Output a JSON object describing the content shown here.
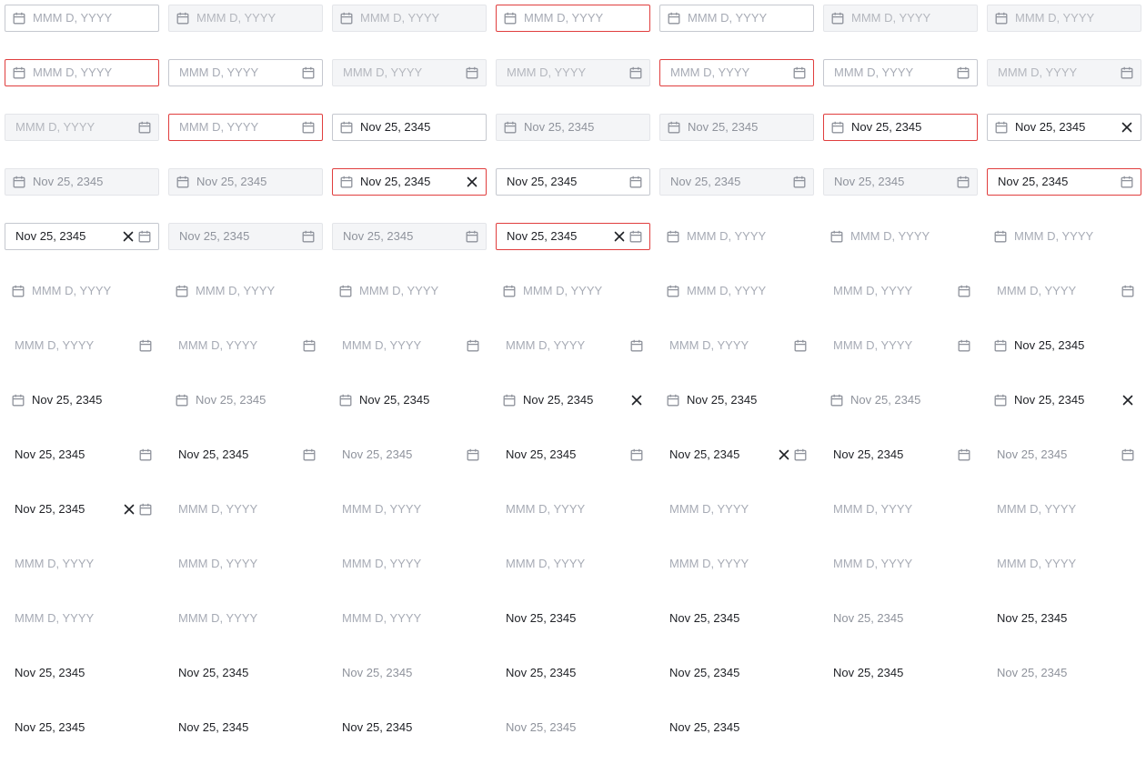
{
  "placeholder": "MMM D, YYYY",
  "date_value": "Nov 25, 2345",
  "icons": {
    "calendar": "calendar-icon",
    "clear": "close-icon"
  },
  "colors": {
    "border": "#c5c8cf",
    "error_border": "#e03e3e",
    "disabled_bg": "#f4f5f7",
    "text": "#1f2126",
    "placeholder": "#a7abb5",
    "icon": "#8f939c"
  },
  "fields": [
    {
      "variant": "outline",
      "icon": "leading",
      "filled": false,
      "state": "normal",
      "clear": false
    },
    {
      "variant": "outline",
      "icon": "leading",
      "filled": false,
      "state": "disabled",
      "clear": false
    },
    {
      "variant": "outline",
      "icon": "leading",
      "filled": false,
      "state": "disabled",
      "clear": false
    },
    {
      "variant": "outline",
      "icon": "leading",
      "filled": false,
      "state": "error",
      "clear": false
    },
    {
      "variant": "outline",
      "icon": "leading",
      "filled": false,
      "state": "normal",
      "clear": false
    },
    {
      "variant": "outline",
      "icon": "leading",
      "filled": false,
      "state": "disabled",
      "clear": false
    },
    {
      "variant": "outline",
      "icon": "leading",
      "filled": false,
      "state": "disabled",
      "clear": false
    },
    {
      "variant": "outline",
      "icon": "leading",
      "filled": false,
      "state": "error",
      "clear": false
    },
    {
      "variant": "outline",
      "icon": "trailing",
      "filled": false,
      "state": "normal",
      "clear": false
    },
    {
      "variant": "outline",
      "icon": "trailing",
      "filled": false,
      "state": "disabled",
      "clear": false
    },
    {
      "variant": "outline",
      "icon": "trailing",
      "filled": false,
      "state": "disabled",
      "clear": false
    },
    {
      "variant": "outline",
      "icon": "trailing",
      "filled": false,
      "state": "error",
      "clear": false
    },
    {
      "variant": "outline",
      "icon": "trailing",
      "filled": false,
      "state": "normal",
      "clear": false
    },
    {
      "variant": "outline",
      "icon": "trailing",
      "filled": false,
      "state": "disabled",
      "clear": false
    },
    {
      "variant": "outline",
      "icon": "trailing",
      "filled": false,
      "state": "disabled",
      "clear": false
    },
    {
      "variant": "outline",
      "icon": "trailing",
      "filled": false,
      "state": "error",
      "clear": false
    },
    {
      "variant": "outline",
      "icon": "leading",
      "filled": true,
      "state": "normal",
      "clear": false
    },
    {
      "variant": "outline",
      "icon": "leading",
      "filled": true,
      "state": "disabled",
      "clear": false
    },
    {
      "variant": "outline",
      "icon": "leading",
      "filled": true,
      "state": "disabled",
      "clear": false
    },
    {
      "variant": "outline",
      "icon": "leading",
      "filled": true,
      "state": "error",
      "clear": false
    },
    {
      "variant": "outline",
      "icon": "leading",
      "filled": true,
      "state": "normal",
      "clear": true
    },
    {
      "variant": "outline",
      "icon": "leading",
      "filled": true,
      "state": "disabled",
      "clear": false
    },
    {
      "variant": "outline",
      "icon": "leading",
      "filled": true,
      "state": "disabled",
      "clear": false
    },
    {
      "variant": "outline",
      "icon": "leading",
      "filled": true,
      "state": "error",
      "clear": true
    },
    {
      "variant": "outline",
      "icon": "trailing",
      "filled": true,
      "state": "normal",
      "clear": false
    },
    {
      "variant": "outline",
      "icon": "trailing",
      "filled": true,
      "state": "disabled",
      "clear": false
    },
    {
      "variant": "outline",
      "icon": "trailing",
      "filled": true,
      "state": "disabled",
      "clear": false
    },
    {
      "variant": "outline",
      "icon": "trailing",
      "filled": true,
      "state": "error",
      "clear": false
    },
    {
      "variant": "outline",
      "icon": "trailing",
      "filled": true,
      "state": "normal",
      "clear": true
    },
    {
      "variant": "outline",
      "icon": "trailing",
      "filled": true,
      "state": "disabled",
      "clear": false
    },
    {
      "variant": "outline",
      "icon": "trailing",
      "filled": true,
      "state": "disabled",
      "clear": false
    },
    {
      "variant": "outline",
      "icon": "trailing",
      "filled": true,
      "state": "error",
      "clear": true
    },
    {
      "variant": "plain",
      "icon": "leading",
      "filled": false,
      "state": "normal",
      "clear": false
    },
    {
      "variant": "plain",
      "icon": "leading",
      "filled": false,
      "state": "normal",
      "clear": false
    },
    {
      "variant": "plain",
      "icon": "leading",
      "filled": false,
      "state": "normal",
      "clear": false
    },
    {
      "variant": "plain",
      "icon": "leading",
      "filled": false,
      "state": "normal",
      "clear": false
    },
    {
      "variant": "plain",
      "icon": "leading",
      "filled": false,
      "state": "normal",
      "clear": false
    },
    {
      "variant": "plain",
      "icon": "leading",
      "filled": false,
      "state": "normal",
      "clear": false
    },
    {
      "variant": "plain",
      "icon": "leading",
      "filled": false,
      "state": "normal",
      "clear": false
    },
    {
      "variant": "plain",
      "icon": "leading",
      "filled": false,
      "state": "normal",
      "clear": false
    },
    {
      "variant": "plain",
      "icon": "trailing",
      "filled": false,
      "state": "normal",
      "clear": false
    },
    {
      "variant": "plain",
      "icon": "trailing",
      "filled": false,
      "state": "normal",
      "clear": false
    },
    {
      "variant": "plain",
      "icon": "trailing",
      "filled": false,
      "state": "normal",
      "clear": false
    },
    {
      "variant": "plain",
      "icon": "trailing",
      "filled": false,
      "state": "normal",
      "clear": false
    },
    {
      "variant": "plain",
      "icon": "trailing",
      "filled": false,
      "state": "normal",
      "clear": false
    },
    {
      "variant": "plain",
      "icon": "trailing",
      "filled": false,
      "state": "normal",
      "clear": false
    },
    {
      "variant": "plain",
      "icon": "trailing",
      "filled": false,
      "state": "normal",
      "clear": false
    },
    {
      "variant": "plain",
      "icon": "trailing",
      "filled": false,
      "state": "normal",
      "clear": false
    },
    {
      "variant": "plain",
      "icon": "leading",
      "filled": true,
      "state": "normal",
      "clear": false
    },
    {
      "variant": "plain",
      "icon": "leading",
      "filled": true,
      "state": "normal",
      "clear": false
    },
    {
      "variant": "plain",
      "icon": "leading",
      "filled": true,
      "state": "disabled",
      "clear": false
    },
    {
      "variant": "plain",
      "icon": "leading",
      "filled": true,
      "state": "normal",
      "clear": false
    },
    {
      "variant": "plain",
      "icon": "leading",
      "filled": true,
      "state": "normal",
      "clear": true
    },
    {
      "variant": "plain",
      "icon": "leading",
      "filled": true,
      "state": "normal",
      "clear": false
    },
    {
      "variant": "plain",
      "icon": "leading",
      "filled": true,
      "state": "disabled",
      "clear": false
    },
    {
      "variant": "plain",
      "icon": "leading",
      "filled": true,
      "state": "normal",
      "clear": true
    },
    {
      "variant": "plain",
      "icon": "trailing",
      "filled": true,
      "state": "normal",
      "clear": false
    },
    {
      "variant": "plain",
      "icon": "trailing",
      "filled": true,
      "state": "normal",
      "clear": false
    },
    {
      "variant": "plain",
      "icon": "trailing",
      "filled": true,
      "state": "disabled",
      "clear": false
    },
    {
      "variant": "plain",
      "icon": "trailing",
      "filled": true,
      "state": "normal",
      "clear": false
    },
    {
      "variant": "plain",
      "icon": "trailing",
      "filled": true,
      "state": "normal",
      "clear": true
    },
    {
      "variant": "plain",
      "icon": "trailing",
      "filled": true,
      "state": "normal",
      "clear": false
    },
    {
      "variant": "plain",
      "icon": "trailing",
      "filled": true,
      "state": "disabled",
      "clear": false
    },
    {
      "variant": "plain",
      "icon": "trailing",
      "filled": true,
      "state": "normal",
      "clear": true
    },
    {
      "variant": "plain",
      "icon": "none",
      "filled": false,
      "state": "normal",
      "clear": false
    },
    {
      "variant": "plain",
      "icon": "none",
      "filled": false,
      "state": "normal",
      "clear": false
    },
    {
      "variant": "plain",
      "icon": "none",
      "filled": false,
      "state": "normal",
      "clear": false
    },
    {
      "variant": "plain",
      "icon": "none",
      "filled": false,
      "state": "normal",
      "clear": false
    },
    {
      "variant": "plain",
      "icon": "none",
      "filled": false,
      "state": "normal",
      "clear": false
    },
    {
      "variant": "plain",
      "icon": "none",
      "filled": false,
      "state": "normal",
      "clear": false
    },
    {
      "variant": "plain",
      "icon": "none",
      "filled": false,
      "state": "normal",
      "clear": false
    },
    {
      "variant": "plain",
      "icon": "none",
      "filled": false,
      "state": "normal",
      "clear": false
    },
    {
      "variant": "plain",
      "icon": "none",
      "filled": false,
      "state": "normal",
      "clear": false
    },
    {
      "variant": "plain",
      "icon": "none",
      "filled": false,
      "state": "normal",
      "clear": false
    },
    {
      "variant": "plain",
      "icon": "none",
      "filled": false,
      "state": "normal",
      "clear": false
    },
    {
      "variant": "plain",
      "icon": "none",
      "filled": false,
      "state": "normal",
      "clear": false
    },
    {
      "variant": "plain",
      "icon": "none",
      "filled": false,
      "state": "normal",
      "clear": false
    },
    {
      "variant": "plain",
      "icon": "none",
      "filled": false,
      "state": "normal",
      "clear": false
    },
    {
      "variant": "plain",
      "icon": "none",
      "filled": false,
      "state": "normal",
      "clear": false
    },
    {
      "variant": "plain",
      "icon": "none",
      "filled": false,
      "state": "normal",
      "clear": false
    },
    {
      "variant": "plain",
      "icon": "none",
      "filled": true,
      "state": "normal",
      "clear": false
    },
    {
      "variant": "plain",
      "icon": "none",
      "filled": true,
      "state": "normal",
      "clear": false
    },
    {
      "variant": "plain",
      "icon": "none",
      "filled": true,
      "state": "disabled",
      "clear": false
    },
    {
      "variant": "plain",
      "icon": "none",
      "filled": true,
      "state": "normal",
      "clear": false
    },
    {
      "variant": "plain",
      "icon": "none",
      "filled": true,
      "state": "normal",
      "clear": false
    },
    {
      "variant": "plain",
      "icon": "none",
      "filled": true,
      "state": "normal",
      "clear": false
    },
    {
      "variant": "plain",
      "icon": "none",
      "filled": true,
      "state": "disabled",
      "clear": false
    },
    {
      "variant": "plain",
      "icon": "none",
      "filled": true,
      "state": "normal",
      "clear": false
    },
    {
      "variant": "plain",
      "icon": "none",
      "filled": true,
      "state": "normal",
      "clear": false
    },
    {
      "variant": "plain",
      "icon": "none",
      "filled": true,
      "state": "normal",
      "clear": false
    },
    {
      "variant": "plain",
      "icon": "none",
      "filled": true,
      "state": "disabled",
      "clear": false
    },
    {
      "variant": "plain",
      "icon": "none",
      "filled": true,
      "state": "normal",
      "clear": false
    },
    {
      "variant": "plain",
      "icon": "none",
      "filled": true,
      "state": "normal",
      "clear": false
    },
    {
      "variant": "plain",
      "icon": "none",
      "filled": true,
      "state": "normal",
      "clear": false
    },
    {
      "variant": "plain",
      "icon": "none",
      "filled": true,
      "state": "disabled",
      "clear": false
    },
    {
      "variant": "plain",
      "icon": "none",
      "filled": true,
      "state": "normal",
      "clear": false
    }
  ]
}
